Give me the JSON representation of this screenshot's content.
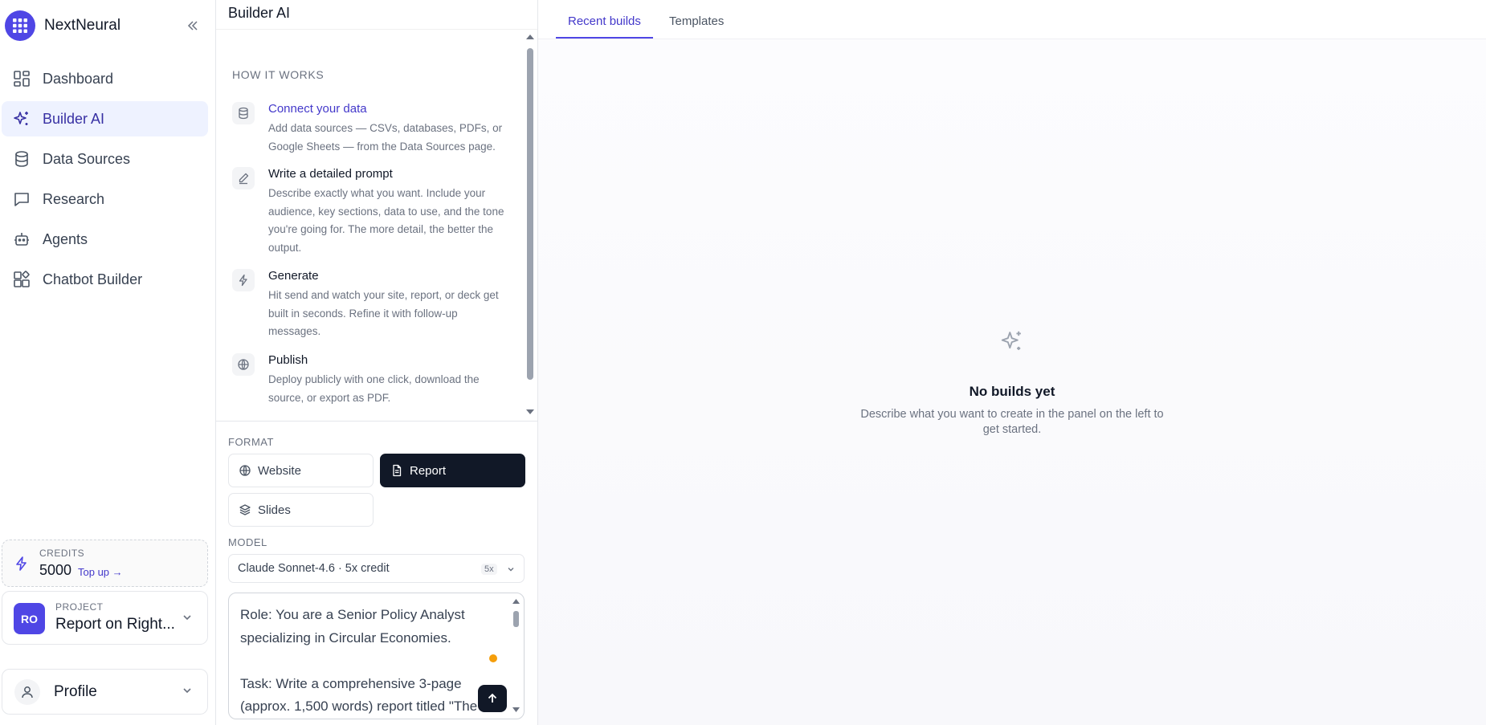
{
  "brand": {
    "name": "NextNeural"
  },
  "nav": [
    {
      "label": "Dashboard",
      "icon": "dashboard-icon"
    },
    {
      "label": "Builder AI",
      "icon": "sparkles-icon",
      "active": true
    },
    {
      "label": "Data Sources",
      "icon": "database-icon"
    },
    {
      "label": "Research",
      "icon": "chat-icon"
    },
    {
      "label": "Agents",
      "icon": "bot-icon"
    },
    {
      "label": "Chatbot Builder",
      "icon": "widgets-icon"
    }
  ],
  "credits": {
    "label": "CREDITS",
    "amount": "5000",
    "topup": "Top up →"
  },
  "project": {
    "label": "PROJECT",
    "initials": "RO",
    "name": "Report on Right..."
  },
  "profile": {
    "name": "Profile"
  },
  "builder": {
    "title": "Builder AI",
    "how_title": "HOW IT WORKS",
    "steps": [
      {
        "title": "Connect your data",
        "desc": "Add data sources — CSVs, databases, PDFs, or Google Sheets — from the Data Sources page.",
        "icon": "database-icon"
      },
      {
        "title": "Write a detailed prompt",
        "desc": "Describe exactly what you want. Include your audience, key sections, data to use, and the tone you're going for. The more detail, the better the output.",
        "icon": "pencil-icon"
      },
      {
        "title": "Generate",
        "desc": "Hit send and watch your site, report, or deck get built in seconds. Refine it with follow-up messages.",
        "icon": "bolt-icon"
      },
      {
        "title": "Publish",
        "desc": "Deploy publicly with one click, download the source, or export as PDF.",
        "icon": "globe-icon"
      }
    ],
    "format_label": "FORMAT",
    "formats": [
      {
        "label": "Website",
        "icon": "globe-icon"
      },
      {
        "label": "Report",
        "icon": "document-icon",
        "active": true
      },
      {
        "label": "Slides",
        "icon": "layers-icon"
      }
    ],
    "model_label": "MODEL",
    "model": {
      "value": "Claude Sonnet-4.6 · 5x credit",
      "badge": "5x"
    },
    "prompt": "Role: You are a Senior Policy Analyst specializing in Circular Economies.\n\nTask: Write a comprehensive 3-page (approx. 1,500 words) report titled \"The"
  },
  "main": {
    "tabs": [
      {
        "label": "Recent builds",
        "active": true
      },
      {
        "label": "Templates"
      }
    ],
    "empty_title": "No builds yet",
    "empty_desc": "Describe what you want to create in the panel on the left to get started."
  },
  "colors": {
    "accent": "#4f46e5",
    "dark": "#111827",
    "muted": "#6b7280",
    "dot": "#f59e0b"
  }
}
